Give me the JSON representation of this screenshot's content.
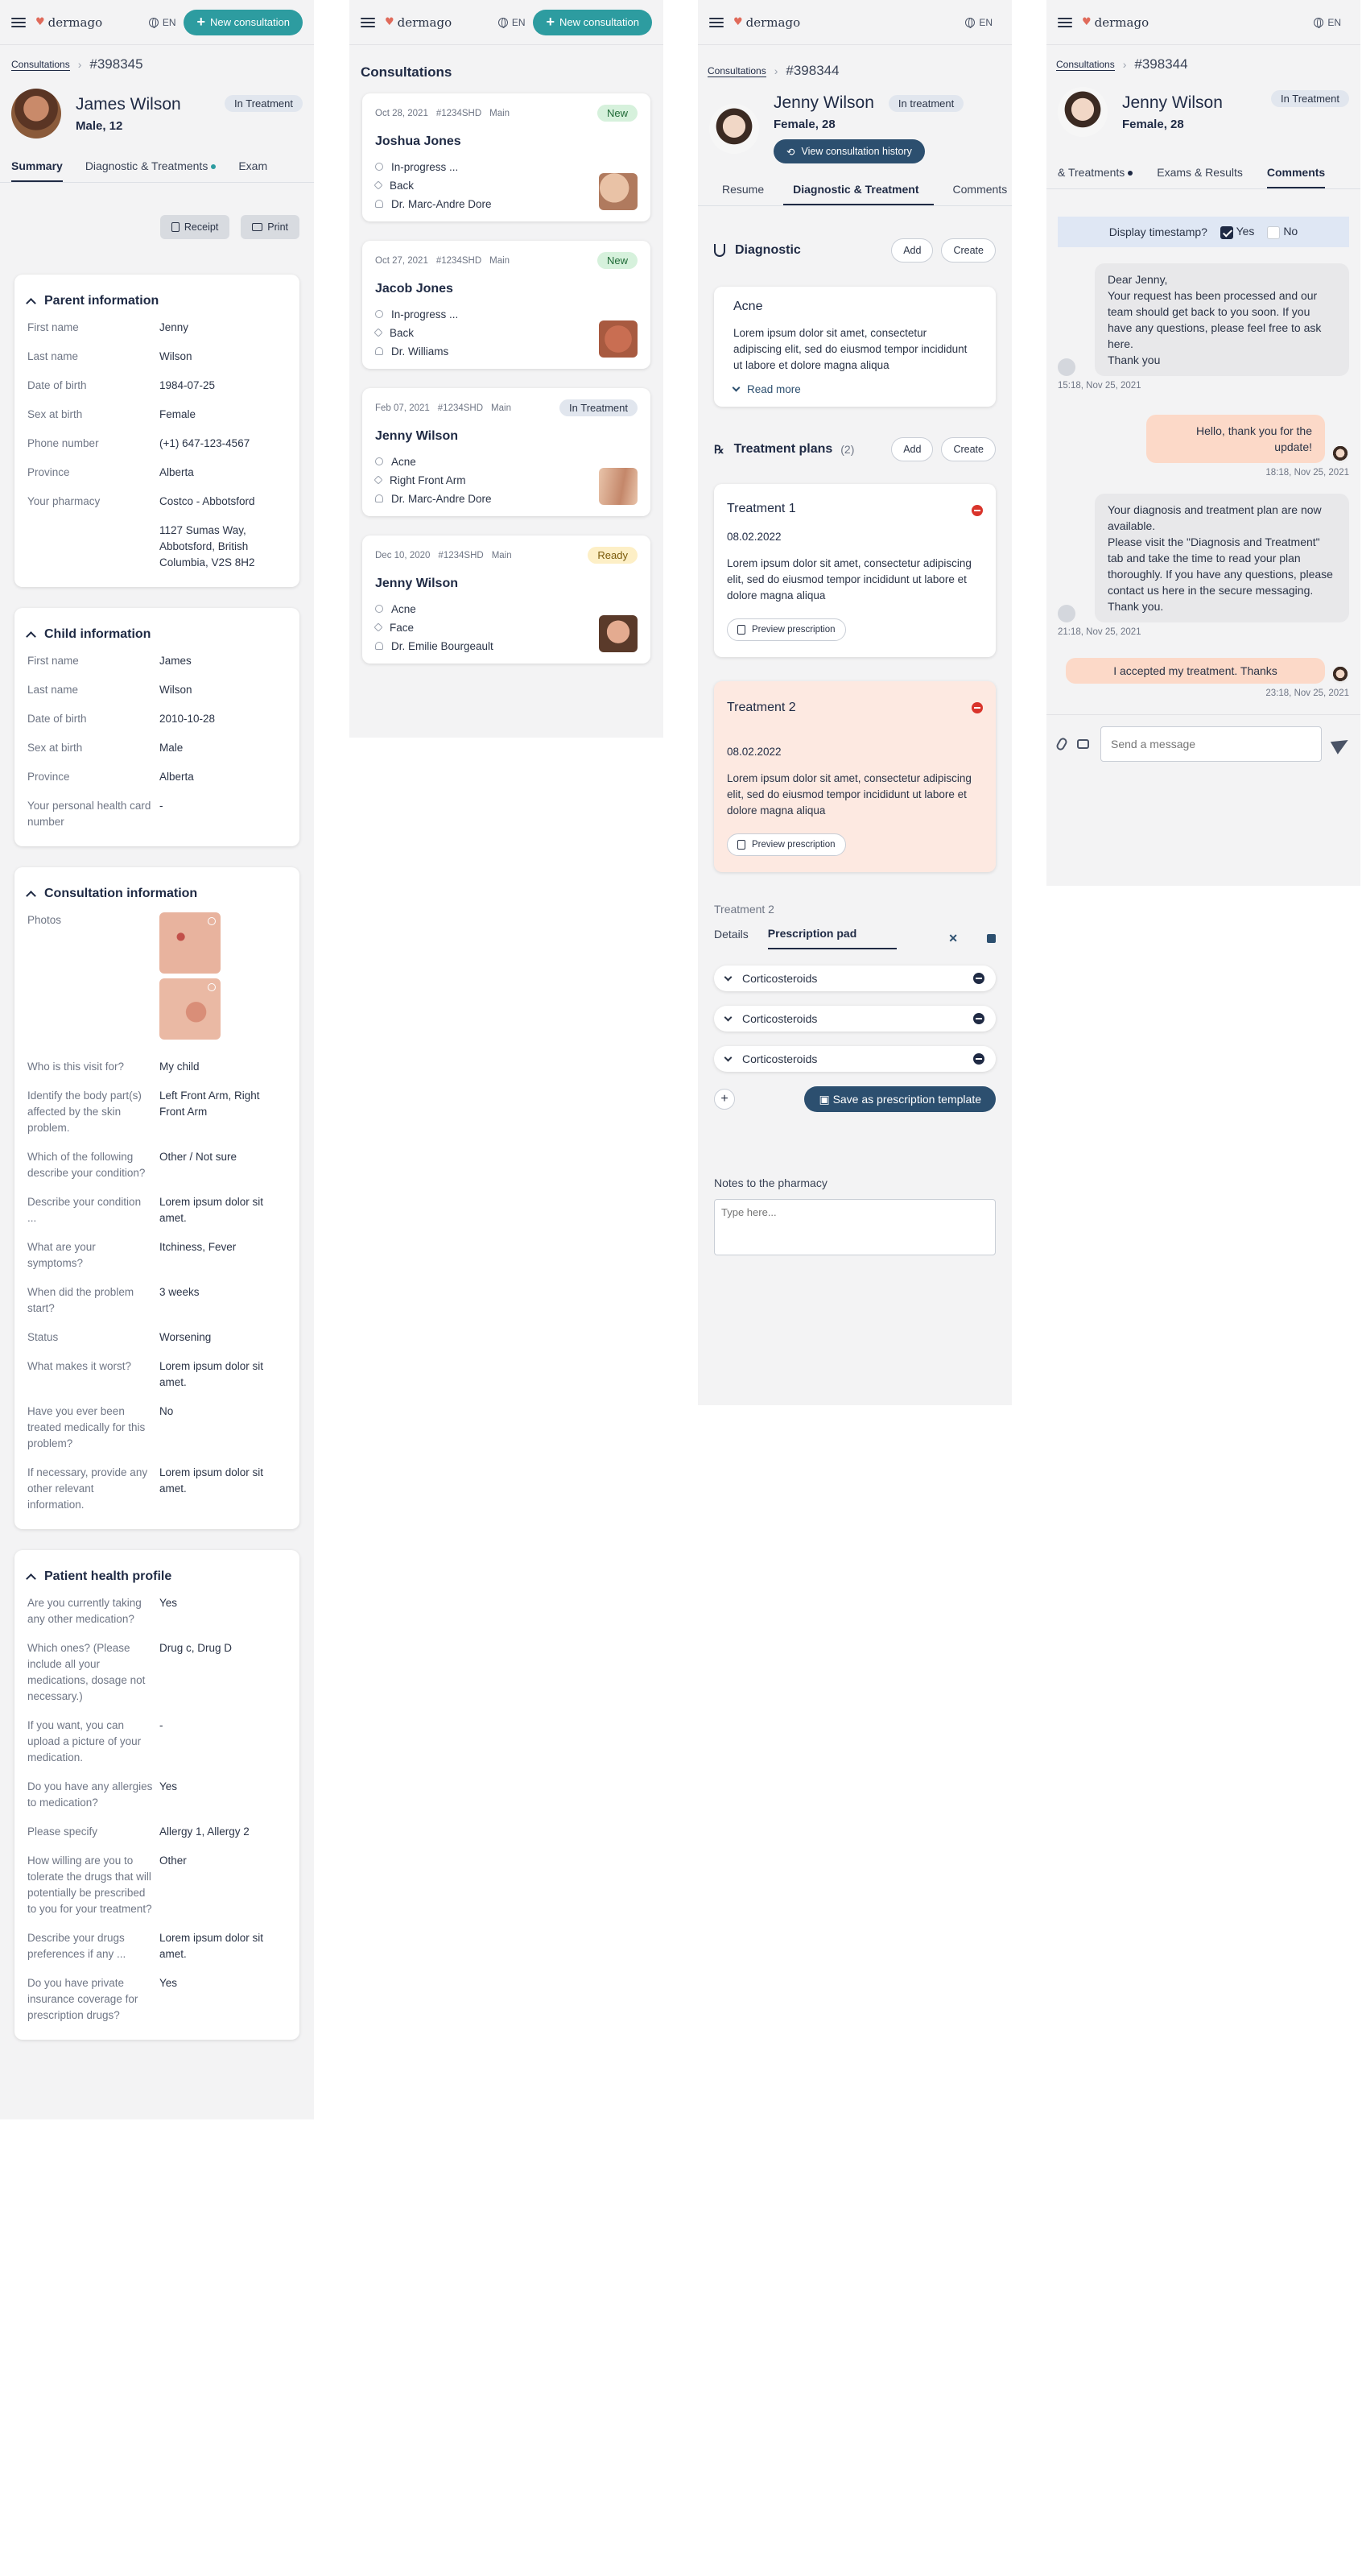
{
  "app": {
    "logo": "dermago",
    "lang": "EN",
    "new_consultation": "New consultation"
  },
  "panel1": {
    "breadcrumb": "Consultations",
    "id": "#398345",
    "patient": {
      "name": "James Wilson",
      "meta": "Male, 12",
      "status": "In Treatment"
    },
    "tabs": [
      "Summary",
      "Diagnostic & Treatments",
      "Exam"
    ],
    "buttons": {
      "receipt": "Receipt",
      "print": "Print"
    },
    "parent": {
      "title": "Parent information",
      "rows": [
        {
          "k": "First name",
          "v": "Jenny"
        },
        {
          "k": "Last name",
          "v": "Wilson"
        },
        {
          "k": "Date of birth",
          "v": "1984-07-25"
        },
        {
          "k": "Sex at birth",
          "v": "Female"
        },
        {
          "k": "Phone number",
          "v": "(+1) 647-123-4567"
        },
        {
          "k": "Province",
          "v": "Alberta"
        },
        {
          "k": "Your pharmacy",
          "v": "Costco - Abbotsford"
        },
        {
          "k": "",
          "v": "1127 Sumas Way, Abbotsford, British Columbia, V2S 8H2"
        }
      ]
    },
    "child": {
      "title": "Child information",
      "rows": [
        {
          "k": "First name",
          "v": "James"
        },
        {
          "k": "Last name",
          "v": "Wilson"
        },
        {
          "k": "Date of birth",
          "v": "2010-10-28"
        },
        {
          "k": "Sex at birth",
          "v": "Male"
        },
        {
          "k": "Province",
          "v": "Alberta"
        },
        {
          "k": "Your personal health card number",
          "v": "-"
        }
      ]
    },
    "consultation": {
      "title": "Consultation information",
      "photos_label": "Photos",
      "rows": [
        {
          "k": "Who is this visit for?",
          "v": "My child"
        },
        {
          "k": "Identify the body part(s) affected by the skin problem.",
          "v": "Left Front Arm, Right Front Arm"
        },
        {
          "k": "Which of the following describe your condition?",
          "v": "Other / Not sure"
        },
        {
          "k": "Describe your condition ...",
          "v": "Lorem ipsum dolor sit amet."
        },
        {
          "k": "What are your symptoms?",
          "v": "Itchiness, Fever"
        },
        {
          "k": "When did the problem start?",
          "v": "3 weeks"
        },
        {
          "k": "Status",
          "v": "Worsening"
        },
        {
          "k": "What makes it worst?",
          "v": "Lorem ipsum dolor sit amet."
        },
        {
          "k": "Have you ever been treated medically for this problem?",
          "v": "No"
        },
        {
          "k": "If necessary, provide any other relevant information.",
          "v": "Lorem ipsum dolor sit amet."
        }
      ]
    },
    "health": {
      "title": "Patient health profile",
      "rows": [
        {
          "k": "Are you currently taking any other medication?",
          "v": "Yes"
        },
        {
          "k": "Which ones? (Please include all your medications, dosage not necessary.)",
          "v": "Drug c, Drug D"
        },
        {
          "k": "If you want, you can upload a picture of your medication.",
          "v": "-"
        },
        {
          "k": "Do you have any allergies to medication?",
          "v": "Yes"
        },
        {
          "k": "Please specify",
          "v": "Allergy 1, Allergy 2"
        },
        {
          "k": "How willing are you to tolerate the drugs that will potentially be prescribed to you for your treatment?",
          "v": "Other"
        },
        {
          "k": "Describe your drugs preferences if any ...",
          "v": "Lorem ipsum dolor sit amet."
        },
        {
          "k": "Do you have private insurance coverage for prescription drugs?",
          "v": "Yes"
        }
      ]
    }
  },
  "panel2": {
    "title": "Consultations",
    "items": [
      {
        "date": "Oct 28, 2021",
        "code": "#1234SHD",
        "type": "Main",
        "status": "New",
        "name": "Joshua Jones",
        "line1": "In-progress ...",
        "line2": "Back",
        "line3": "Dr. Marc-Andre Dore"
      },
      {
        "date": "Oct 27, 2021",
        "code": "#1234SHD",
        "type": "Main",
        "status": "New",
        "name": "Jacob Jones",
        "line1": "In-progress ...",
        "line2": "Back",
        "line3": "Dr. Williams"
      },
      {
        "date": "Feb 07, 2021",
        "code": "#1234SHD",
        "type": "Main",
        "status": "In Treatment",
        "name": "Jenny Wilson",
        "line1": "Acne",
        "line2": "Right Front Arm",
        "line3": "Dr. Marc-Andre Dore"
      },
      {
        "date": "Dec 10, 2020",
        "code": "#1234SHD",
        "type": "Main",
        "status": "Ready",
        "name": "Jenny Wilson",
        "line1": "Acne",
        "line2": "Face",
        "line3": "Dr. Emilie Bourgeault"
      }
    ]
  },
  "panel3": {
    "breadcrumb": "Consultations",
    "id": "#398344",
    "patient": {
      "name": "Jenny Wilson",
      "meta": "Female, 28",
      "status": "In treatment"
    },
    "history_button": "View consultation history",
    "tabs": [
      "Resume",
      "Diagnostic & Treatment",
      "Comments"
    ],
    "diagnostic": {
      "title": "Diagnostic",
      "add": "Add",
      "create": "Create",
      "card_title": "Acne",
      "text": "Lorem ipsum dolor sit amet, consectetur adipiscing elit, sed do eiusmod tempor incididunt ut labore et dolore magna aliqua",
      "read_more": "Read more"
    },
    "plans": {
      "title": "Treatment plans",
      "count": "(2)",
      "add": "Add",
      "create": "Create"
    },
    "treatments": [
      {
        "title": "Treatment 1",
        "date": "08.02.2022",
        "text": "Lorem ipsum dolor sit amet, consectetur adipiscing elit, sed do eiusmod tempor incididunt ut labore et dolore magna aliqua",
        "preview": "Preview prescription"
      },
      {
        "title": "Treatment 2",
        "date": "08.02.2022",
        "text": "Lorem ipsum dolor sit amet, consectetur adipiscing elit, sed do eiusmod tempor incididunt ut labore et dolore magna aliqua",
        "preview": "Preview prescription"
      }
    ],
    "editor": {
      "label": "Treatment 2",
      "tab_details": "Details",
      "tab_pad": "Prescription pad",
      "items": [
        "Corticosteroids",
        "Corticosteroids",
        "Corticosteroids"
      ],
      "save": "Save as prescription template",
      "notes_label": "Notes to the pharmacy",
      "notes_placeholder": "Type here..."
    }
  },
  "panel4": {
    "breadcrumb": "Consultations",
    "id": "#398344",
    "patient": {
      "name": "Jenny Wilson",
      "meta": "Female, 28",
      "status": "In Treatment"
    },
    "tabs": [
      "& Treatments",
      "Exams & Results",
      "Comments"
    ],
    "timestamp": {
      "label": "Display timestamp?",
      "yes": "Yes",
      "no": "No"
    },
    "messages": [
      {
        "text": "Dear Jenny,\nYour request has been processed and our team should get back to you soon. If you have any questions, please feel free to ask here.\nThank you",
        "time": "15:18, Nov 25, 2021"
      },
      {
        "text": "Hello, thank you for the update!",
        "time": "18:18, Nov 25, 2021"
      },
      {
        "text": "Your diagnosis and treatment plan are now available.\nPlease visit the \"Diagnosis and Treatment\" tab and take the time to read your plan thoroughly. If you have any questions, please contact us here in the secure messaging.\nThank you.",
        "time": "21:18, Nov 25, 2021"
      },
      {
        "text": "I accepted my treatment. Thanks",
        "time": "23:18, Nov 25, 2021"
      }
    ],
    "composer_placeholder": "Send a message"
  }
}
